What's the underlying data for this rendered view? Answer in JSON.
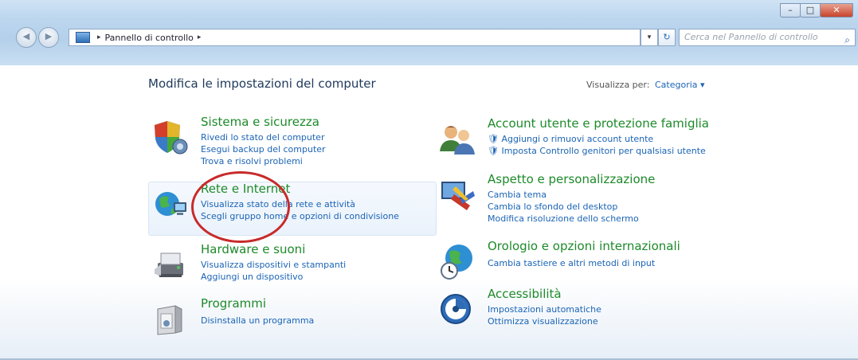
{
  "window": {
    "controls": {
      "minimize": "–",
      "maximize": "□",
      "close": "✕"
    }
  },
  "nav": {
    "back": "◀",
    "forward": "▶"
  },
  "address": {
    "separator": "▸",
    "crumb": "Pannello di controllo",
    "trailing_arrow": "▸",
    "dropdown": "▾",
    "refresh": "↻"
  },
  "search": {
    "placeholder": "Cerca nel Pannello di controllo",
    "icon": "⌕"
  },
  "content": {
    "header": "Modifica le impostazioni del computer",
    "view_by_label": "Visualizza per:",
    "view_by_value": "Categoria ▾"
  },
  "categories_left": [
    {
      "title": "Sistema e sicurezza",
      "links": [
        "Rivedi lo stato del computer",
        "Esegui backup del computer",
        "Trova e risolvi problemi"
      ]
    },
    {
      "title": "Rete e Internet",
      "links": [
        "Visualizza stato della rete e attività",
        "Scegli gruppo home e opzioni di condivisione"
      ]
    },
    {
      "title": "Hardware e suoni",
      "links": [
        "Visualizza dispositivi e stampanti",
        "Aggiungi un dispositivo"
      ]
    },
    {
      "title": "Programmi",
      "links": [
        "Disinstalla un programma"
      ]
    }
  ],
  "categories_right": [
    {
      "title": "Account utente e protezione famiglia",
      "links": [
        "Aggiungi o rimuovi account utente",
        "Imposta Controllo genitori per qualsiasi utente"
      ]
    },
    {
      "title": "Aspetto e personalizzazione",
      "links": [
        "Cambia tema",
        "Cambia lo sfondo del desktop",
        "Modifica risoluzione dello schermo"
      ]
    },
    {
      "title": "Orologio e opzioni internazionali",
      "links": [
        "Cambia tastiere e altri metodi di input"
      ]
    },
    {
      "title": "Accessibilità",
      "links": [
        "Impostazioni automatiche",
        "Ottimizza visualizzazione"
      ]
    }
  ],
  "colors": {
    "title_green": "#1d8a2a",
    "link_blue": "#1b64b5",
    "annotation_red": "#c82a2a"
  }
}
